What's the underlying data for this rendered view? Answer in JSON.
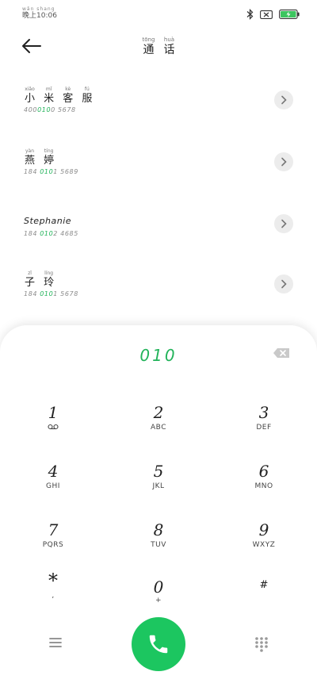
{
  "status_bar": {
    "ruby": "wǎn shang",
    "time": "晚上10:06"
  },
  "header": {
    "title": [
      {
        "py": "tōng",
        "hz": "通"
      },
      {
        "py": "huà",
        "hz": "话"
      }
    ]
  },
  "contacts": [
    {
      "name": [
        {
          "py": "xiǎo",
          "hz": "小"
        },
        {
          "py": "mǐ",
          "hz": "米"
        },
        {
          "py": "kè",
          "hz": "客"
        },
        {
          "py": "fú",
          "hz": "服"
        }
      ],
      "number_pre": "400",
      "number_hl": "010",
      "number_post": "0 5678"
    },
    {
      "name": [
        {
          "py": "yàn",
          "hz": "燕"
        },
        {
          "py": "tíng",
          "hz": "婷"
        }
      ],
      "number_pre": "184 ",
      "number_hl": "010",
      "number_post": "1 5689"
    },
    {
      "name_plain": "Stephanie",
      "number_pre": "184 ",
      "number_hl": "010",
      "number_post": "2 4685"
    },
    {
      "name": [
        {
          "py": "zǐ",
          "hz": "子"
        },
        {
          "py": "líng",
          "hz": "玲"
        }
      ],
      "number_pre": "184 ",
      "number_hl": "010",
      "number_post": "1 5678"
    }
  ],
  "dialer": {
    "input": "010",
    "keys": [
      {
        "digit": "1",
        "letters": ""
      },
      {
        "digit": "2",
        "letters": "ABC"
      },
      {
        "digit": "3",
        "letters": "DEF"
      },
      {
        "digit": "4",
        "letters": "GHI"
      },
      {
        "digit": "5",
        "letters": "JKL"
      },
      {
        "digit": "6",
        "letters": "MNO"
      },
      {
        "digit": "7",
        "letters": "PQRS"
      },
      {
        "digit": "8",
        "letters": "TUV"
      },
      {
        "digit": "9",
        "letters": "WXYZ"
      },
      {
        "digit": "*",
        "letters": ","
      },
      {
        "digit": "0",
        "letters": "+"
      },
      {
        "digit": "#",
        "letters": ""
      }
    ]
  },
  "colors": {
    "accent_green": "#22b35a",
    "call_button": "#1cc660"
  },
  "icons": {
    "back": "arrow-left-icon",
    "bluetooth": "bluetooth-icon",
    "sim": "no-sim-icon",
    "battery": "battery-charging-icon",
    "detail": "chevron-right-icon",
    "backspace": "backspace-icon",
    "voicemail": "voicemail-icon",
    "menu": "menu-icon",
    "call": "phone-icon",
    "dialpad": "dialpad-icon"
  }
}
